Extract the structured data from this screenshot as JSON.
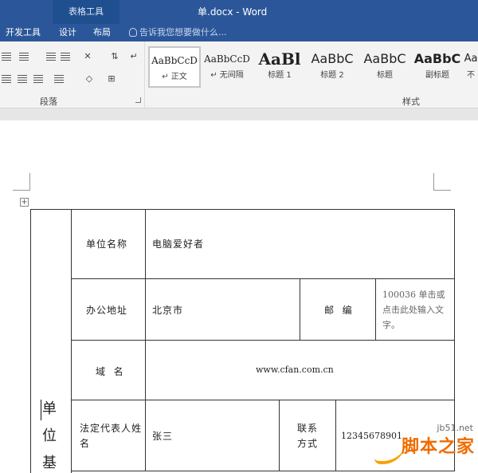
{
  "titlebar": {
    "context_tab_group": "表格工具",
    "document_title": "单.docx - Word"
  },
  "ribbon_tabs": {
    "developer": "开发工具",
    "design": "设计",
    "layout": "布局",
    "tell_me": "告诉我您想要做什么..."
  },
  "paragraph_group": {
    "label": "段落"
  },
  "styles_group": {
    "label": "样式",
    "styles": [
      {
        "sample": "AaBbCcD",
        "name": "↵ 正文"
      },
      {
        "sample": "AaBbCcD",
        "name": "↵ 无间隔"
      },
      {
        "sample": "AaBl",
        "name": "标题 1"
      },
      {
        "sample": "AaBbC",
        "name": "标题 2"
      },
      {
        "sample": "AaBbC",
        "name": "标题"
      },
      {
        "sample": "AaBbC",
        "name": "副标题"
      },
      {
        "sample": "Aa",
        "name": "不"
      }
    ]
  },
  "table": {
    "side_label": [
      "单",
      "位",
      "基"
    ],
    "rows": {
      "unit_name_label": "单位名称",
      "unit_name_value": "电脑爱好者",
      "address_label": "办公地址",
      "address_value": "北京市",
      "postcode_label": "邮  编",
      "postcode_value": "100036 单击或点击此处输入文字。",
      "domain_label": "域  名",
      "domain_value": "www.cfan.com.cn",
      "legal_rep_label": "法定代表人姓    名",
      "legal_rep_value": "张三",
      "contact_label": "联系方式",
      "contact_value": "12345678901"
    }
  },
  "watermark": {
    "url": "jb51.net",
    "name": "脚本之家"
  }
}
